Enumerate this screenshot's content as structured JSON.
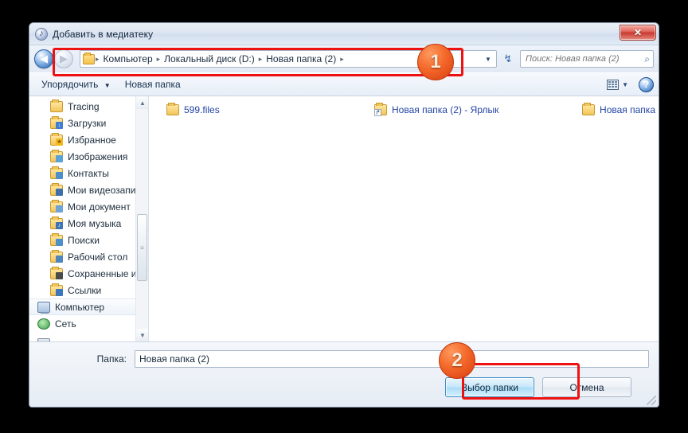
{
  "window": {
    "title": "Добавить в медиатеку",
    "title_icon": "music-note-icon",
    "close_label": "✕"
  },
  "nav": {
    "back_icon": "◀",
    "forward_icon": "▶",
    "dropdown_icon": "▼",
    "refresh_icon": "↯",
    "breadcrumbs": [
      "Компьютер",
      "Локальный диск (D:)",
      "Новая папка (2)"
    ],
    "separator": "▸"
  },
  "search": {
    "placeholder": "Поиск: Новая папка (2)",
    "value": "",
    "icon": "search-icon",
    "icon_glyph": "⌕"
  },
  "toolbar": {
    "organize_label": "Упорядочить",
    "organize_caret": "▼",
    "new_folder_label": "Новая папка",
    "view_caret": "▼",
    "help_label": "?"
  },
  "sidebar": {
    "items": [
      {
        "label": "Tracing",
        "icon": "folder-icon",
        "badge": ""
      },
      {
        "label": "Загрузки",
        "icon": "folder-download-icon",
        "badge": "↓"
      },
      {
        "label": "Избранное",
        "icon": "folder-favorites-icon",
        "badge": "★"
      },
      {
        "label": "Изображения",
        "icon": "folder-pictures-icon",
        "badge": ""
      },
      {
        "label": "Контакты",
        "icon": "folder-contacts-icon",
        "badge": ""
      },
      {
        "label": "Мои видеозапи",
        "icon": "folder-videos-icon",
        "badge": ""
      },
      {
        "label": "Мои документ",
        "icon": "folder-documents-icon",
        "badge": ""
      },
      {
        "label": "Моя музыка",
        "icon": "folder-music-icon",
        "badge": "♪"
      },
      {
        "label": "Поиски",
        "icon": "folder-searches-icon",
        "badge": ""
      },
      {
        "label": "Рабочий стол",
        "icon": "folder-desktop-icon",
        "badge": ""
      },
      {
        "label": "Сохраненные и",
        "icon": "folder-games-icon",
        "badge": ""
      },
      {
        "label": "Ссылки",
        "icon": "folder-links-icon",
        "badge": ""
      },
      {
        "label": "Компьютер",
        "icon": "computer-icon",
        "badge": "",
        "selected": true,
        "root": true
      },
      {
        "label": "Сеть",
        "icon": "network-icon",
        "badge": "",
        "root": true
      },
      {
        "label": "",
        "icon": "drive-icon",
        "badge": "",
        "root": true
      }
    ],
    "scroll_up_icon": "▲",
    "scroll_down_icon": "▼",
    "thumb_grip": "≡"
  },
  "files": {
    "items": [
      {
        "label": "599.files",
        "icon": "folder-icon",
        "type": "folder"
      },
      {
        "label": "Новая папка (2) - Ярлык",
        "icon": "shortcut-icon",
        "type": "shortcut"
      },
      {
        "label": "Новая папка",
        "icon": "folder-icon",
        "type": "folder"
      }
    ]
  },
  "footer": {
    "folder_label": "Папка:",
    "folder_value": "Новая папка (2)",
    "folder_placeholder": "",
    "select_button": "Выбор папки",
    "cancel_button": "Отмена"
  },
  "annotations": {
    "badge_1": "1",
    "badge_2": "2",
    "color": "#ee1111"
  }
}
